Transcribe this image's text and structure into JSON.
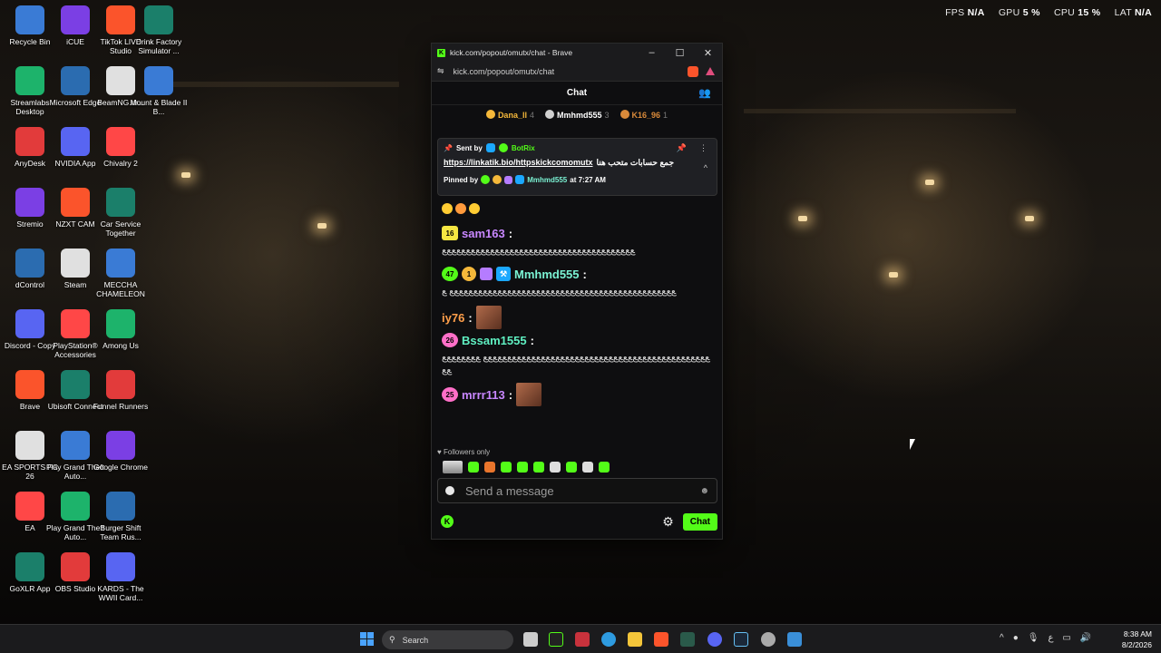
{
  "overlay": {
    "fps_label": "FPS",
    "fps": "N/A",
    "gpu_label": "GPU",
    "gpu": "5 %",
    "cpu_label": "CPU",
    "cpu": "15 %",
    "lat_label": "LAT",
    "lat": "N/A"
  },
  "desktop": {
    "col1": [
      "Recycle Bin",
      "Streamlabs Desktop",
      "AnyDesk",
      "Stremio",
      "dControl",
      "Discord - Copy",
      "Brave",
      "EA SPORTS FC 26",
      "EA",
      "GoXLR App"
    ],
    "col2": [
      "iCUE",
      "Microsoft Edge",
      "NVIDIA App",
      "NZXT CAM",
      "Steam",
      "PlayStation® Accessories",
      "Ubisoft Connect",
      "Play Grand Theft Auto...",
      "Play Grand Theft Auto...",
      "OBS Studio"
    ],
    "col3": [
      "TikTok LIVE Studio",
      "BeamNG.dr...",
      "Chivalry 2",
      "Car Service Together",
      "MECCHA CHAMELEON",
      "Among Us",
      "Funnel Runners",
      "Google Chrome",
      "Burger Shift Team Rus...",
      "KARDS - The WWII Card..."
    ],
    "col4": [
      "Drink Factory Simulator ...",
      "Mount & Blade II B..."
    ]
  },
  "browser": {
    "title": "kick.com/popout/omutx/chat - Brave",
    "url": "kick.com/popout/omutx/chat"
  },
  "chat": {
    "header": "Chat",
    "leaders": [
      {
        "name": "Dana_ll",
        "count": "4",
        "color": "#f5b83a"
      },
      {
        "name": "Mmhmd555",
        "count": "3",
        "color": "#d0d0d0"
      },
      {
        "name": "K16_96",
        "count": "1",
        "color": "#d98a3a"
      }
    ],
    "pinned": {
      "sent_by_label": "Sent by",
      "sender": "BotRix",
      "message_ar": "جمع حسابات متحب هنا",
      "link": "https://linkatik.bio/httpskickcomomutx",
      "pinned_by_label": "Pinned by",
      "pinned_by": "Mmhmd555",
      "time": "at 7:27 AM"
    },
    "messages": [
      {
        "badge": "16",
        "badge_color": "#f5e642",
        "user": "sam163",
        "color": "#c887ff",
        "text": "ﻊﻊﻊﻊﻊﻊﻊﻊﻊﻊﻊﻊﻊﻊﻊﻊﻊﻊﻊﻊﻊﻊﻊﻊﻊﻊﻊﻊﻊﻊﻊﻊﻊﻊﻊﻊﻊﻊﻊﻊ"
      },
      {
        "badge": "47",
        "badge_color": "#53fc18",
        "user": "Mmhmd555",
        "color": "#7bf3d4",
        "text": "ﻊﻊﻊﻊﻊﻊﻊﻊﻊﻊﻊﻊﻊﻊﻊﻊﻊﻊﻊﻊﻊﻊﻊﻊﻊﻊﻊﻊﻊﻊﻊﻊﻊﻊﻊﻊﻊﻊﻊﻊﻊﻊﻊﻊﻊﻊﻊ ﻊ"
      },
      {
        "user": "iy76",
        "color": "#ff9f4a"
      },
      {
        "badge": "26",
        "badge_color": "#ff6fc8",
        "user": "Bssam1555",
        "color": "#5ff0c2",
        "text": "ﻊﻊﻊﻊﻊﻊﻊﻊﻊﻊﻊﻊﻊﻊﻊﻊﻊﻊﻊﻊﻊﻊﻊﻊﻊﻊﻊﻊﻊﻊﻊﻊﻊﻊﻊﻊﻊﻊﻊﻊﻊﻊﻊﻊﻊﻊﻊ ﻊﻊﻊﻊﻊﻊﻊﻊﻊﻊ"
      },
      {
        "badge": "25",
        "badge_color": "#ff6fc8",
        "user": "mrrr113",
        "color": "#c887ff"
      }
    ],
    "followers_only": "Followers only",
    "input_placeholder": "Send a message",
    "send_label": "Chat"
  },
  "taskbar": {
    "search": "Search",
    "time": "8:38 AM",
    "date": "8/2/2026"
  }
}
